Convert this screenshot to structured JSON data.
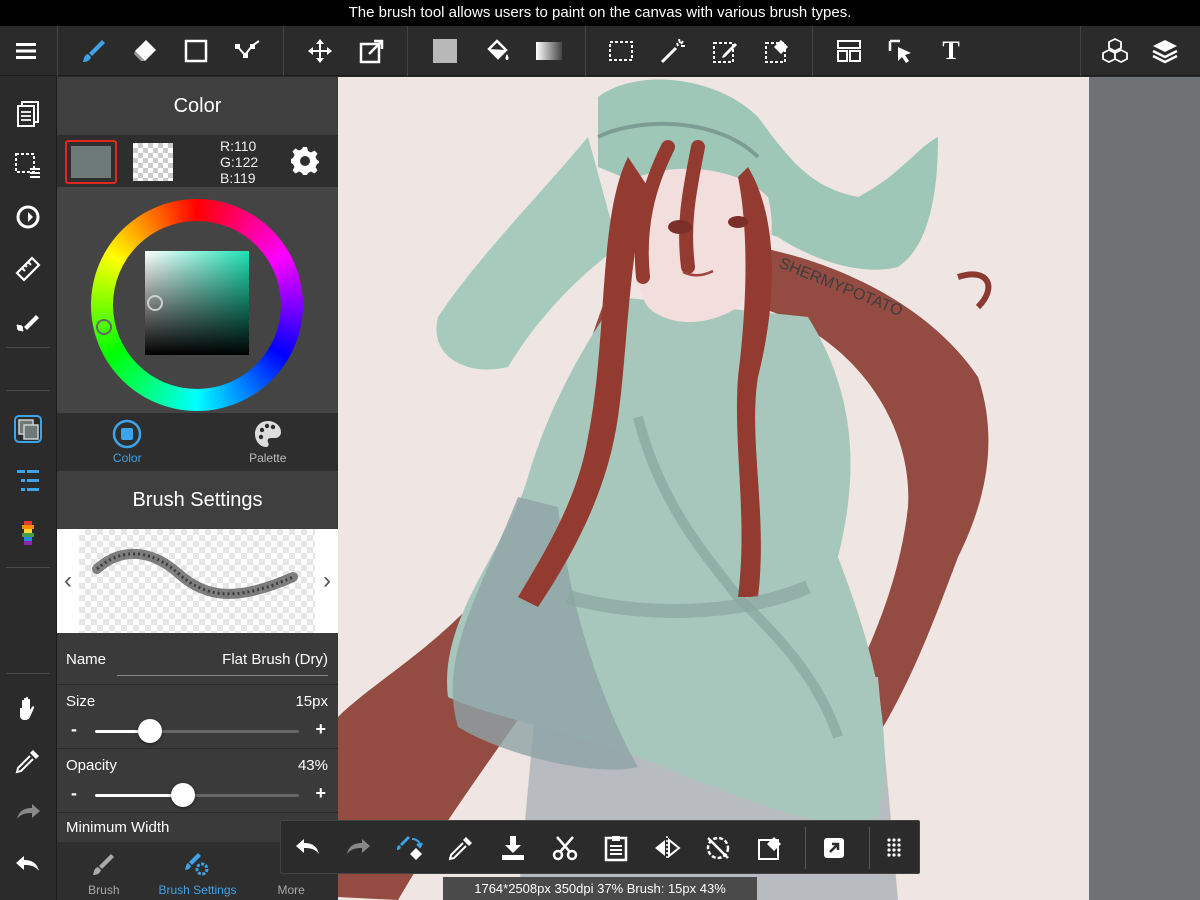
{
  "tooltip": "The brush tool allows users to paint on the canvas with various brush types.",
  "toolbar": {
    "text_tool_label": "T"
  },
  "panel": {
    "color_title": "Color",
    "rgb": {
      "r": "R:110",
      "g": "G:122",
      "b": "B:119"
    },
    "foreground_color": "#6e7a77",
    "tabs": [
      {
        "label": "Color",
        "active": true
      },
      {
        "label": "Palette",
        "active": false
      }
    ],
    "brush_settings_title": "Brush Settings",
    "name_label": "Name",
    "name_value": "Flat Brush (Dry)",
    "size": {
      "label": "Size",
      "value": "15px",
      "level": 0.27
    },
    "opacity": {
      "label": "Opacity",
      "value": "43%",
      "level": 0.43
    },
    "minimum_width_label": "Minimum Width",
    "bottom_tabs": [
      {
        "label": "Brush",
        "active": false
      },
      {
        "label": "Brush Settings",
        "active": true
      },
      {
        "label": "More",
        "active": false
      }
    ],
    "minus": "-",
    "plus": "+"
  },
  "canvas": {
    "watermark": "SHERMYPOTATO"
  },
  "status_bar": "1764*2508px 350dpi 37% Brush: 15px 43%",
  "colors": {
    "accent": "#3ea4ea",
    "selected_border": "#e0281f"
  }
}
